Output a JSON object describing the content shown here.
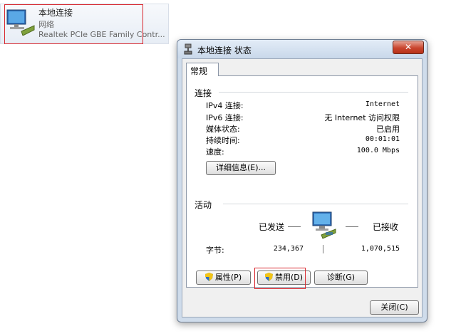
{
  "adapter": {
    "name": "本地连接",
    "network": "网络",
    "device": "Realtek PCIe GBE Family Contr..."
  },
  "dialog": {
    "title": "本地连接 状态",
    "close_glyph": "✕",
    "tab": "常规",
    "connection": {
      "heading": "连接",
      "rows": [
        {
          "label": "IPv4 连接:",
          "value": "Internet"
        },
        {
          "label": "IPv6 连接:",
          "value": "无 Internet 访问权限"
        },
        {
          "label": "媒体状态:",
          "value": "已启用"
        },
        {
          "label": "持续时间:",
          "value": "00:01:01"
        },
        {
          "label": "速度:",
          "value": "100.0 Mbps"
        }
      ],
      "details_button": "详细信息(E)..."
    },
    "activity": {
      "heading": "活动",
      "sent_label": "已发送",
      "received_label": "已接收",
      "bytes_label": "字节:",
      "bytes_sent": "234,367",
      "bytes_received": "1,070,515"
    },
    "buttons": {
      "properties": "属性(P)",
      "disable": "禁用(D)",
      "diagnose": "诊断(G)",
      "close": "关闭(C)"
    }
  }
}
